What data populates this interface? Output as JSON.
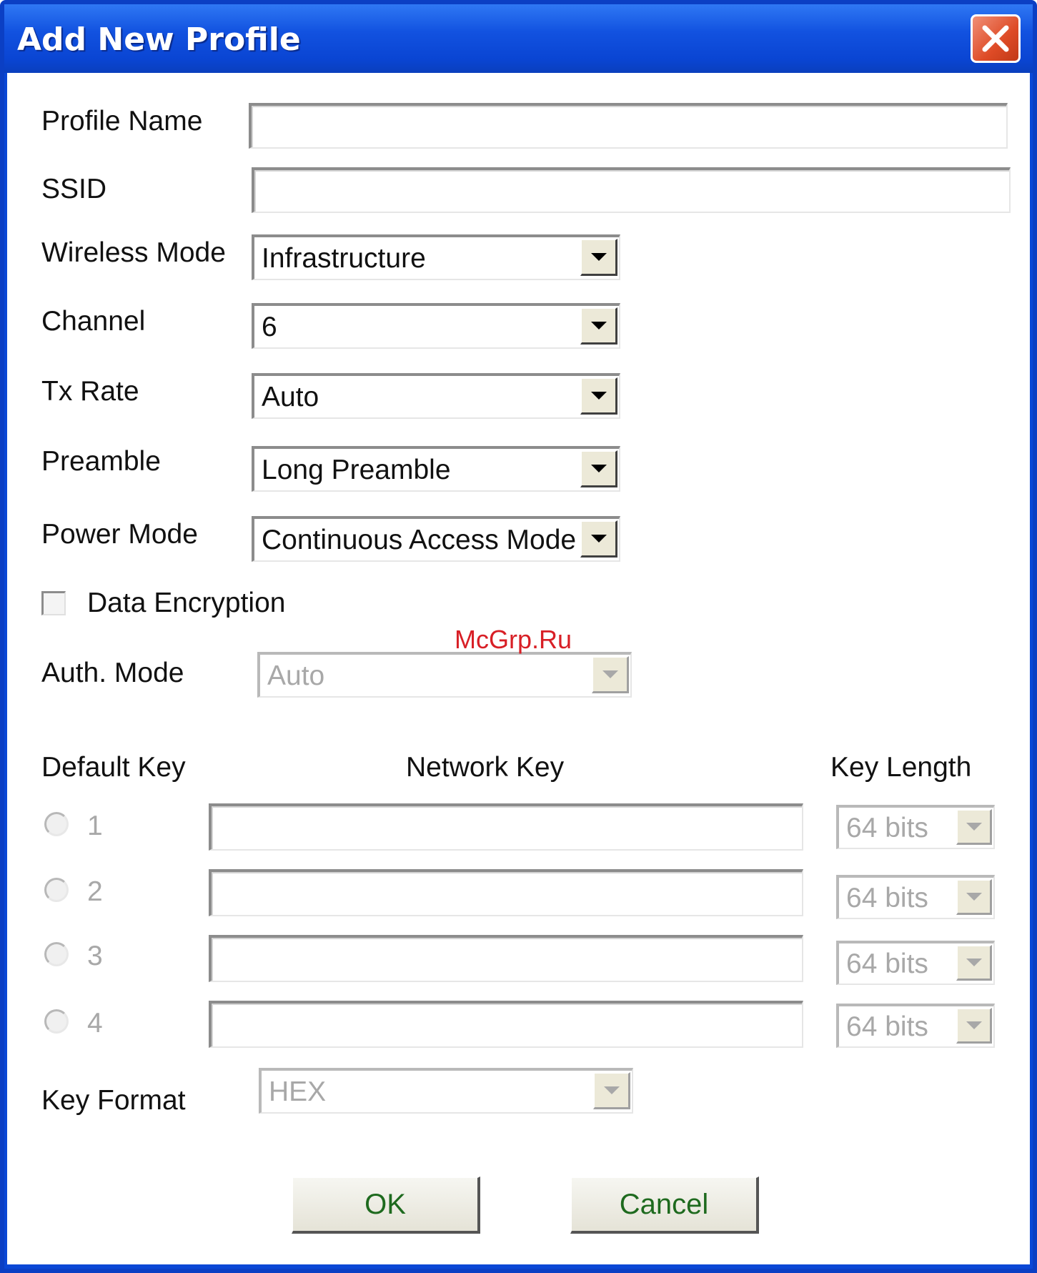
{
  "window": {
    "title": "Add New Profile",
    "close_label": "close"
  },
  "form": {
    "profile_name": {
      "label": "Profile Name",
      "value": ""
    },
    "ssid": {
      "label": "SSID",
      "value": ""
    },
    "wireless_mode": {
      "label": "Wireless Mode",
      "value": "Infrastructure"
    },
    "channel": {
      "label": "Channel",
      "value": "6"
    },
    "tx_rate": {
      "label": "Tx Rate",
      "value": "Auto"
    },
    "preamble": {
      "label": "Preamble",
      "value": "Long Preamble"
    },
    "power_mode": {
      "label": "Power Mode",
      "value": "Continuous Access Mode"
    },
    "data_encryption": {
      "label": "Data Encryption",
      "checked": false
    },
    "auth_mode": {
      "label": "Auth. Mode",
      "value": "Auto",
      "enabled": false
    }
  },
  "keys": {
    "headers": {
      "default_key": "Default Key",
      "network_key": "Network Key",
      "key_length": "Key Length"
    },
    "rows": [
      {
        "index": "1",
        "network_key": "",
        "key_length": "64 bits"
      },
      {
        "index": "2",
        "network_key": "",
        "key_length": "64 bits"
      },
      {
        "index": "3",
        "network_key": "",
        "key_length": "64 bits"
      },
      {
        "index": "4",
        "network_key": "",
        "key_length": "64 bits"
      }
    ]
  },
  "key_format": {
    "label": "Key Format",
    "value": "HEX",
    "enabled": false
  },
  "buttons": {
    "ok": "OK",
    "cancel": "Cancel"
  },
  "watermark": "McGrp.Ru",
  "colors": {
    "titlebar": "#0a48d6",
    "close_button": "#de4b26",
    "button_text": "#1e6a1e",
    "watermark": "#d81f26"
  }
}
